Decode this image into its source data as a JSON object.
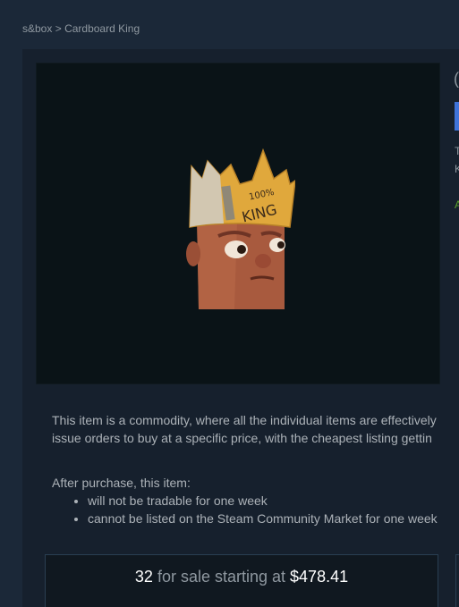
{
  "breadcrumb": {
    "root": "s&box",
    "separator": ">",
    "current": "Cardboard King"
  },
  "item_art": {
    "crown_text_line1": "100%",
    "crown_text_line2": "KING"
  },
  "right_column": {
    "title_fragment": "(",
    "text_line1_fragment": "T",
    "text_line2_fragment": "K",
    "status_fragment": "A"
  },
  "description": {
    "line1": "This item is a commodity, where all the individual items are effectively",
    "line2": "issue orders to buy at a specific price, with the cheapest listing gettin"
  },
  "after_purchase": {
    "heading": "After purchase, this item:",
    "bullets": [
      "will not be tradable for one week",
      "cannot be listed on the Steam Community Market for one week"
    ]
  },
  "sale": {
    "count": "32",
    "mid_text": "for sale starting at",
    "price": "$478.41"
  },
  "colors": {
    "background": "#1b2838",
    "accent_blue": "#3f73d9",
    "status_green": "#5ba32b"
  }
}
